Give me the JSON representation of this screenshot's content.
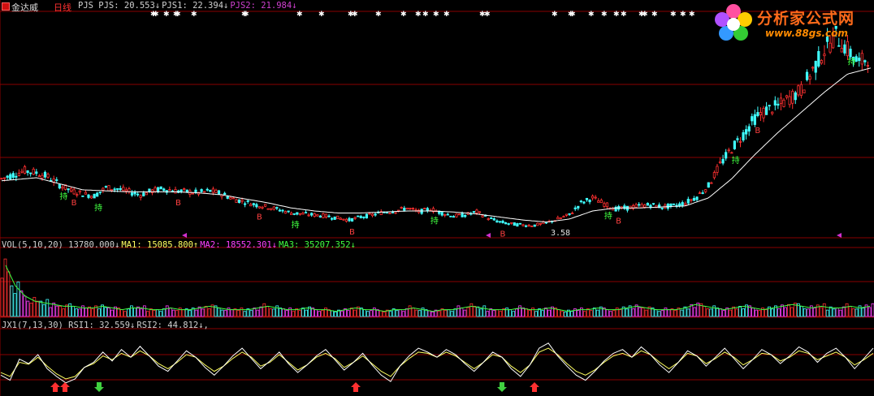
{
  "header": {
    "stock_name": "金达威",
    "period": "日线",
    "main_indicator": [
      {
        "label": "PJS PJS: ",
        "value": "20.553",
        "arrow": "↓",
        "color": "#d0d0d0"
      },
      {
        "label": "PJS1: ",
        "value": "22.394",
        "arrow": "↓",
        "color": "#d0d0d0"
      },
      {
        "label": "PJS2: ",
        "value": "21.984",
        "arrow": "↓",
        "color": "#d040d0"
      }
    ]
  },
  "vol_header": [
    {
      "label": "VOL(5,10,20) ",
      "value": "13780.000",
      "arrow": "↓",
      "color": "#d0d0d0"
    },
    {
      "label": "MA1: ",
      "value": "15085.800",
      "arrow": "↑",
      "color": "#ffff60"
    },
    {
      "label": "MA2: ",
      "value": "18552.301",
      "arrow": "↓",
      "color": "#ff40ff"
    },
    {
      "label": "MA3: ",
      "value": "35207.352",
      "arrow": "↓",
      "color": "#40ff40"
    }
  ],
  "rsi_header": [
    {
      "label": "JX1(7,13,30) RSI1: ",
      "value": "32.559",
      "arrow": "↓",
      "color": "#d0d0d0"
    },
    {
      "label": "RSI2: ",
      "value": "44.812",
      "arrow": "↓,",
      "color": "#d0d0d0"
    }
  ],
  "annotations": {
    "low_price": "3.58"
  },
  "watermark": {
    "title": "分析家公式网",
    "url": "www.88gs.com"
  },
  "colors": {
    "up": "#ff3030",
    "down": "#40ffff",
    "ma_white": "#ffffff",
    "grid": "#8a0000",
    "buy_marker": "#ff3030",
    "sell_marker": "#40d040",
    "signal_text_green": "#40ff40",
    "signal_text_red": "#ff4040",
    "magenta": "#d030d0"
  },
  "chart_data": [
    {
      "type": "candlestick",
      "title": "",
      "note": "Daily price with moving average (approximate shape, no y-axis labels)",
      "price_path": [
        [
          0,
          8.2
        ],
        [
          2,
          8.6
        ],
        [
          4,
          9.0
        ],
        [
          6,
          8.8
        ],
        [
          8,
          8.4
        ],
        [
          10,
          7.6
        ],
        [
          12,
          7.0
        ],
        [
          14,
          6.7
        ],
        [
          16,
          6.5
        ],
        [
          18,
          7.3
        ],
        [
          20,
          7.2
        ],
        [
          22,
          6.9
        ],
        [
          24,
          6.6
        ],
        [
          26,
          7.0
        ],
        [
          28,
          7.2
        ],
        [
          30,
          7.0
        ],
        [
          32,
          6.9
        ],
        [
          34,
          6.8
        ],
        [
          36,
          7.0
        ],
        [
          38,
          6.7
        ],
        [
          40,
          6.2
        ],
        [
          42,
          5.9
        ],
        [
          44,
          5.6
        ],
        [
          46,
          5.4
        ],
        [
          48,
          5.1
        ],
        [
          50,
          4.8
        ],
        [
          52,
          4.7
        ],
        [
          54,
          4.6
        ],
        [
          56,
          4.5
        ],
        [
          58,
          4.3
        ],
        [
          60,
          4.1
        ],
        [
          62,
          4.4
        ],
        [
          64,
          4.6
        ],
        [
          66,
          4.9
        ],
        [
          68,
          5.0
        ],
        [
          70,
          5.3
        ],
        [
          72,
          4.9
        ],
        [
          74,
          5.2
        ],
        [
          76,
          4.8
        ],
        [
          78,
          4.5
        ],
        [
          80,
          4.6
        ],
        [
          82,
          4.9
        ],
        [
          84,
          4.3
        ],
        [
          86,
          3.9
        ],
        [
          88,
          3.7
        ],
        [
          90,
          3.6
        ],
        [
          92,
          3.58
        ],
        [
          94,
          3.8
        ],
        [
          96,
          4.2
        ],
        [
          98,
          4.6
        ],
        [
          100,
          5.8
        ],
        [
          102,
          6.3
        ],
        [
          104,
          5.7
        ],
        [
          106,
          5.2
        ],
        [
          108,
          5.3
        ],
        [
          110,
          5.5
        ],
        [
          112,
          5.6
        ],
        [
          114,
          5.4
        ],
        [
          116,
          5.5
        ],
        [
          118,
          5.8
        ],
        [
          120,
          6.4
        ],
        [
          122,
          7.5
        ],
        [
          124,
          9.6
        ],
        [
          126,
          11.2
        ],
        [
          128,
          12.6
        ],
        [
          130,
          14.2
        ],
        [
          132,
          15.0
        ],
        [
          134,
          15.4
        ],
        [
          136,
          16.2
        ],
        [
          138,
          17.0
        ],
        [
          140,
          19.0
        ],
        [
          142,
          21.0
        ],
        [
          144,
          22.4
        ],
        [
          146,
          21.0
        ],
        [
          148,
          19.6
        ],
        [
          150,
          20.55
        ]
      ],
      "ma_path": [
        [
          0,
          8.0
        ],
        [
          6,
          8.3
        ],
        [
          10,
          7.7
        ],
        [
          14,
          7.1
        ],
        [
          18,
          7.0
        ],
        [
          22,
          6.9
        ],
        [
          26,
          6.9
        ],
        [
          30,
          6.9
        ],
        [
          34,
          6.8
        ],
        [
          38,
          6.6
        ],
        [
          42,
          6.2
        ],
        [
          46,
          5.8
        ],
        [
          50,
          5.3
        ],
        [
          54,
          5.0
        ],
        [
          58,
          4.8
        ],
        [
          62,
          4.8
        ],
        [
          66,
          4.9
        ],
        [
          70,
          5.0
        ],
        [
          74,
          5.0
        ],
        [
          78,
          4.9
        ],
        [
          82,
          4.7
        ],
        [
          86,
          4.4
        ],
        [
          90,
          4.1
        ],
        [
          94,
          3.9
        ],
        [
          98,
          4.2
        ],
        [
          102,
          5.0
        ],
        [
          106,
          5.3
        ],
        [
          110,
          5.3
        ],
        [
          114,
          5.4
        ],
        [
          118,
          5.5
        ],
        [
          122,
          6.3
        ],
        [
          126,
          8.2
        ],
        [
          130,
          10.6
        ],
        [
          134,
          12.8
        ],
        [
          138,
          14.8
        ],
        [
          142,
          16.8
        ],
        [
          146,
          18.6
        ],
        [
          150,
          19.2
        ]
      ]
    },
    {
      "type": "bar",
      "title": "VOL(5,10,20)",
      "note": "Volume bars, approximate relative heights",
      "values": [
        30,
        18,
        12,
        9,
        8,
        7,
        6,
        6,
        5,
        5,
        6,
        5,
        4,
        5,
        5,
        4,
        4,
        5,
        4,
        4,
        5,
        6,
        5,
        4,
        4,
        4,
        5,
        6,
        5,
        4,
        4,
        5,
        4,
        4,
        3,
        4,
        5,
        4,
        4,
        3,
        4,
        4,
        5,
        4,
        3,
        4,
        4,
        5,
        6,
        5,
        4,
        4,
        4,
        5,
        4,
        4,
        5,
        4,
        3,
        4,
        4,
        5,
        4,
        4,
        5,
        6,
        5,
        4,
        4,
        4,
        5,
        7,
        6,
        5,
        4,
        5,
        6,
        5,
        4,
        5,
        6,
        7,
        6,
        5,
        6,
        5,
        5,
        6,
        5,
        6
      ]
    },
    {
      "type": "line",
      "title": "JX1(7,13,30)",
      "series": [
        {
          "name": "RSI1",
          "values": [
            30,
            22,
            55,
            48,
            62,
            40,
            28,
            18,
            24,
            42,
            50,
            66,
            52,
            70,
            58,
            75,
            60,
            44,
            36,
            52,
            68,
            58,
            42,
            30,
            44,
            60,
            72,
            56,
            40,
            52,
            66,
            48,
            34,
            46,
            60,
            70,
            54,
            38,
            50,
            64,
            46,
            30,
            20,
            44,
            60,
            72,
            66,
            58,
            70,
            62,
            48,
            36,
            50,
            66,
            58,
            40,
            28,
            46,
            72,
            80,
            60,
            44,
            30,
            22,
            36,
            52,
            64,
            70,
            58,
            74,
            62,
            46,
            34,
            50,
            68,
            60,
            44,
            58,
            72,
            56,
            40,
            54,
            70,
            62,
            48,
            60,
            74,
            66,
            50,
            64,
            72,
            58,
            40,
            56,
            72
          ]
        },
        {
          "name": "RSI2",
          "values": [
            34,
            28,
            50,
            47,
            58,
            44,
            32,
            24,
            28,
            42,
            48,
            60,
            54,
            64,
            58,
            68,
            60,
            48,
            40,
            50,
            62,
            58,
            46,
            36,
            44,
            56,
            66,
            58,
            44,
            50,
            62,
            50,
            38,
            46,
            58,
            64,
            56,
            42,
            50,
            60,
            48,
            36,
            28,
            44,
            56,
            66,
            64,
            58,
            66,
            60,
            50,
            40,
            50,
            62,
            58,
            44,
            34,
            46,
            66,
            72,
            62,
            48,
            36,
            30,
            38,
            50,
            60,
            64,
            58,
            68,
            62,
            50,
            40,
            50,
            64,
            60,
            48,
            56,
            66,
            58,
            46,
            54,
            64,
            62,
            52,
            58,
            68,
            64,
            54,
            60,
            66,
            58,
            46,
            54,
            64
          ]
        }
      ]
    }
  ]
}
